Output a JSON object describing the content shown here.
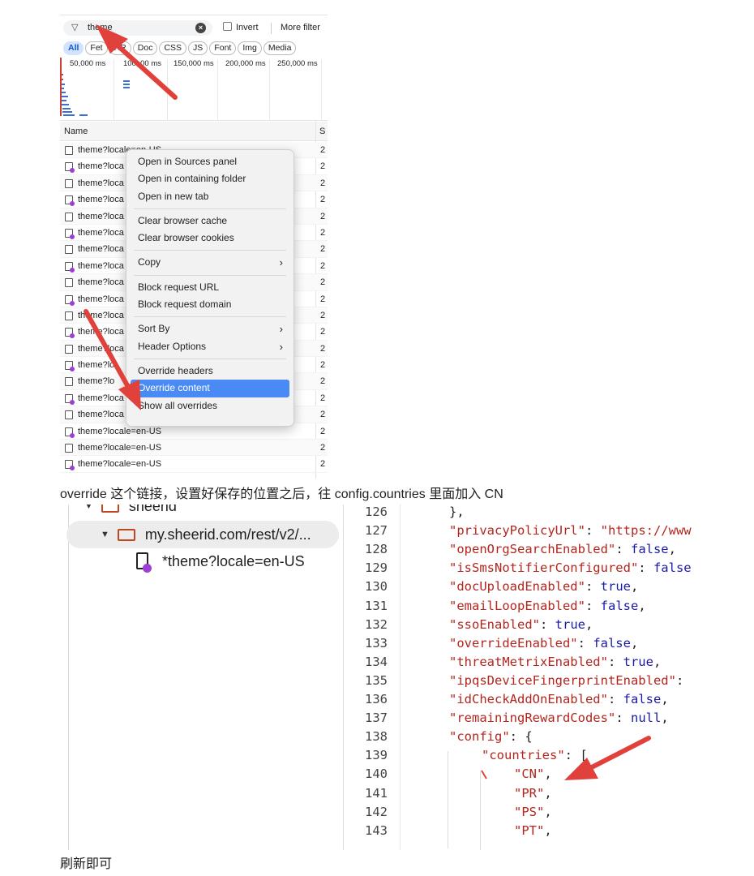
{
  "devtools": {
    "filter": {
      "value": "theme",
      "invert_label": "Invert",
      "more_filters_label": "More filter"
    },
    "type_filters": [
      "All",
      "Fetch/XHR",
      "Doc",
      "CSS",
      "JS",
      "Font",
      "Img",
      "Media"
    ],
    "type_filter_display": [
      "All",
      "Fet",
      "HR",
      "Doc",
      "CSS",
      "JS",
      "Font",
      "Img",
      "Media"
    ],
    "timeline_ticks": [
      "50,000 ms",
      "100,000 ms",
      "150,000 ms",
      "200,000 ms",
      "250,000 ms"
    ],
    "timeline_ticks_display": [
      "50,000 ms",
      "100,  00 ms",
      "150,000 ms",
      "200,000 ms",
      "250,000 ms"
    ],
    "columns": {
      "name": "Name",
      "status": "S"
    },
    "rows": [
      {
        "name": "theme?locale=en-US",
        "status": "2",
        "icon": "plain"
      },
      {
        "name": "theme?loca",
        "status": "2",
        "icon": "doc"
      },
      {
        "name": "theme?loca",
        "status": "2",
        "icon": "plain"
      },
      {
        "name": "theme?loca",
        "status": "2",
        "icon": "doc"
      },
      {
        "name": "theme?loca",
        "status": "2",
        "icon": "plain"
      },
      {
        "name": "theme?loca",
        "status": "2",
        "icon": "doc"
      },
      {
        "name": "theme?loca",
        "status": "2",
        "icon": "plain"
      },
      {
        "name": "theme?loca",
        "status": "2",
        "icon": "doc"
      },
      {
        "name": "theme?loca",
        "status": "2",
        "icon": "plain"
      },
      {
        "name": "theme?loca",
        "status": "2",
        "icon": "doc"
      },
      {
        "name": "theme?loca",
        "status": "2",
        "icon": "plain"
      },
      {
        "name": "theme?loca",
        "status": "2",
        "icon": "doc"
      },
      {
        "name": "theme?loca",
        "status": "2",
        "icon": "plain"
      },
      {
        "name": "theme?lo",
        "status": "2",
        "icon": "doc"
      },
      {
        "name": "theme?lo",
        "status": "2",
        "icon": "plain"
      },
      {
        "name": "theme?loca",
        "status": "2",
        "icon": "doc"
      },
      {
        "name": "theme?loca",
        "status": "2",
        "icon": "plain"
      },
      {
        "name": "theme?locale=en-US",
        "status": "2",
        "icon": "doc"
      },
      {
        "name": "theme?locale=en-US",
        "status": "2",
        "icon": "plain"
      },
      {
        "name": "theme?locale=en-US",
        "status": "2",
        "icon": "doc"
      }
    ],
    "context_menu": [
      {
        "label": "Open in Sources panel"
      },
      {
        "label": "Open in containing folder"
      },
      {
        "label": "Open in new tab"
      },
      {
        "sep": true
      },
      {
        "label": "Clear browser cache"
      },
      {
        "label": "Clear browser cookies"
      },
      {
        "sep": true
      },
      {
        "label": "Copy",
        "submenu": true
      },
      {
        "sep": true
      },
      {
        "label": "Block request URL"
      },
      {
        "label": "Block request domain"
      },
      {
        "sep": true
      },
      {
        "label": "Sort By",
        "submenu": true
      },
      {
        "label": "Header Options",
        "submenu": true
      },
      {
        "sep": true
      },
      {
        "label": "Override headers"
      },
      {
        "label": "Override content",
        "selected": true
      },
      {
        "label": "Show all overrides"
      }
    ]
  },
  "caption": "override 这个链接，设置好保存的位置之后，往 config.countries 里面加入 CN",
  "sources": {
    "tree": {
      "parent_folder": "sheerid",
      "folder": "my.sheerid.com/rest/v2/...",
      "file": "*theme?locale=en-US"
    },
    "lines": [
      {
        "n": "126",
        "indent": 0,
        "parts": [
          [
            "p",
            "},"
          ]
        ]
      },
      {
        "n": "127",
        "indent": 0,
        "parts": [
          [
            "k",
            "\"privacyPolicyUrl\""
          ],
          [
            "p",
            ": "
          ],
          [
            "s",
            "\"https://www"
          ]
        ]
      },
      {
        "n": "128",
        "indent": 0,
        "parts": [
          [
            "k",
            "\"openOrgSearchEnabled\""
          ],
          [
            "p",
            ": "
          ],
          [
            "b",
            "false"
          ],
          [
            "p",
            ","
          ]
        ]
      },
      {
        "n": "129",
        "indent": 0,
        "parts": [
          [
            "k",
            "\"isSmsNotifierConfigured\""
          ],
          [
            "p",
            ": "
          ],
          [
            "b",
            "false"
          ]
        ]
      },
      {
        "n": "130",
        "indent": 0,
        "parts": [
          [
            "k",
            "\"docUploadEnabled\""
          ],
          [
            "p",
            ": "
          ],
          [
            "b",
            "true"
          ],
          [
            "p",
            ","
          ]
        ]
      },
      {
        "n": "131",
        "indent": 0,
        "parts": [
          [
            "k",
            "\"emailLoopEnabled\""
          ],
          [
            "p",
            ": "
          ],
          [
            "b",
            "false"
          ],
          [
            "p",
            ","
          ]
        ]
      },
      {
        "n": "132",
        "indent": 0,
        "parts": [
          [
            "k",
            "\"ssoEnabled\""
          ],
          [
            "p",
            ": "
          ],
          [
            "b",
            "true"
          ],
          [
            "p",
            ","
          ]
        ]
      },
      {
        "n": "133",
        "indent": 0,
        "parts": [
          [
            "k",
            "\"overrideEnabled\""
          ],
          [
            "p",
            ": "
          ],
          [
            "b",
            "false"
          ],
          [
            "p",
            ","
          ]
        ]
      },
      {
        "n": "134",
        "indent": 0,
        "parts": [
          [
            "k",
            "\"threatMetrixEnabled\""
          ],
          [
            "p",
            ": "
          ],
          [
            "b",
            "true"
          ],
          [
            "p",
            ","
          ]
        ]
      },
      {
        "n": "135",
        "indent": 0,
        "parts": [
          [
            "k",
            "\"ipqsDeviceFingerprintEnabled\""
          ],
          [
            "p",
            ":"
          ]
        ]
      },
      {
        "n": "136",
        "indent": 0,
        "parts": [
          [
            "k",
            "\"idCheckAddOnEnabled\""
          ],
          [
            "p",
            ": "
          ],
          [
            "b",
            "false"
          ],
          [
            "p",
            ","
          ]
        ]
      },
      {
        "n": "137",
        "indent": 0,
        "parts": [
          [
            "k",
            "\"remainingRewardCodes\""
          ],
          [
            "p",
            ": "
          ],
          [
            "b",
            "null"
          ],
          [
            "p",
            ","
          ]
        ]
      },
      {
        "n": "138",
        "indent": 0,
        "parts": [
          [
            "k",
            "\"config\""
          ],
          [
            "p",
            ": {"
          ]
        ]
      },
      {
        "n": "139",
        "indent": 1,
        "parts": [
          [
            "k",
            "\"countries\""
          ],
          [
            "p",
            ": ["
          ]
        ]
      },
      {
        "n": "140",
        "indent": 2,
        "parts": [
          [
            "s",
            "\"CN\""
          ],
          [
            "p",
            ","
          ]
        ]
      },
      {
        "n": "141",
        "indent": 2,
        "parts": [
          [
            "s",
            "\"PR\""
          ],
          [
            "p",
            ","
          ]
        ]
      },
      {
        "n": "142",
        "indent": 2,
        "parts": [
          [
            "s",
            "\"PS\""
          ],
          [
            "p",
            ","
          ]
        ]
      },
      {
        "n": "143",
        "indent": 2,
        "parts": [
          [
            "s",
            "\"PT\""
          ],
          [
            "p",
            ","
          ]
        ]
      }
    ]
  },
  "footer": "刷新即可",
  "colors": {
    "accent_red": "#e0413b",
    "menu_selected": "#4a8af4",
    "json_key": "#b3261e",
    "json_literal": "#1a1aa6"
  }
}
